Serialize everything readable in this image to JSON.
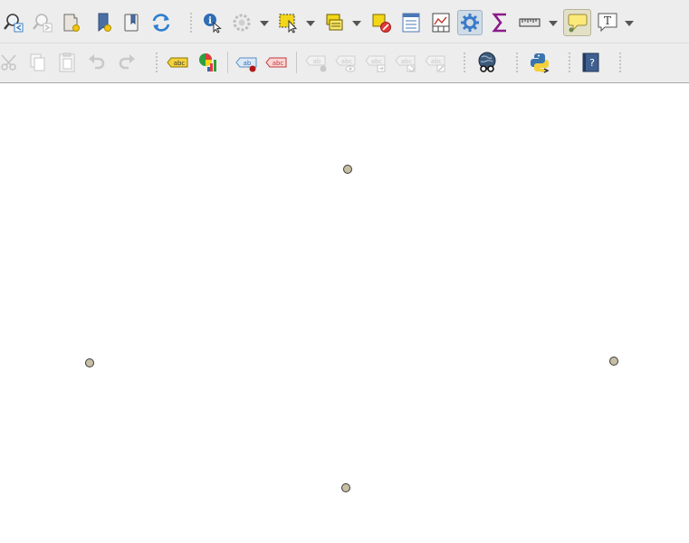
{
  "toolbar_top": {
    "buttons": [
      {
        "icon": "zoom-last-icon"
      },
      {
        "icon": "zoom-next-icon"
      },
      {
        "icon": "new-map-view-icon"
      },
      {
        "icon": "new-bookmark-icon"
      },
      {
        "icon": "show-bookmarks-icon"
      },
      {
        "icon": "refresh-icon"
      },
      {
        "icon": "identify-features-icon"
      },
      {
        "icon": "run-feature-action-icon"
      },
      {
        "icon": "select-features-icon"
      },
      {
        "icon": "select-by-value-icon"
      },
      {
        "icon": "deselect-features-icon"
      },
      {
        "icon": "attribute-table-icon"
      },
      {
        "icon": "field-calculator-icon"
      },
      {
        "icon": "processing-toolbox-icon",
        "active": true
      },
      {
        "icon": "statistical-summary-icon"
      },
      {
        "icon": "measure-line-icon"
      },
      {
        "icon": "map-tips-icon",
        "active": true
      },
      {
        "icon": "text-annotation-icon"
      }
    ]
  },
  "toolbar_bottom": {
    "buttons": [
      {
        "icon": "cut-features-icon"
      },
      {
        "icon": "copy-features-icon"
      },
      {
        "icon": "paste-features-icon"
      },
      {
        "icon": "undo-icon"
      },
      {
        "icon": "redo-icon"
      },
      {
        "icon": "layer-labeling-icon",
        "text": "abc"
      },
      {
        "icon": "layer-diagram-icon"
      },
      {
        "icon": "pin-labels-icon",
        "text": "ab"
      },
      {
        "icon": "highlight-pinned-labels-icon",
        "text": "abc"
      },
      {
        "icon": "move-label-icon",
        "text": "ab"
      },
      {
        "icon": "show-hide-labels-icon",
        "text": "abc"
      },
      {
        "icon": "move-label-diagram-icon",
        "text": "abc"
      },
      {
        "icon": "rotate-label-icon",
        "text": "abc"
      },
      {
        "icon": "change-label-icon",
        "text": "abc"
      },
      {
        "icon": "metasearch-icon"
      },
      {
        "icon": "python-console-icon"
      },
      {
        "icon": "help-icon",
        "text": "?"
      }
    ]
  },
  "map_canvas": {
    "point_fill": "#c7bfa4",
    "point_stroke": "#383838",
    "points": [
      {
        "name": "point-top"
      },
      {
        "name": "point-left"
      },
      {
        "name": "point-right"
      },
      {
        "name": "point-bottom"
      }
    ]
  }
}
